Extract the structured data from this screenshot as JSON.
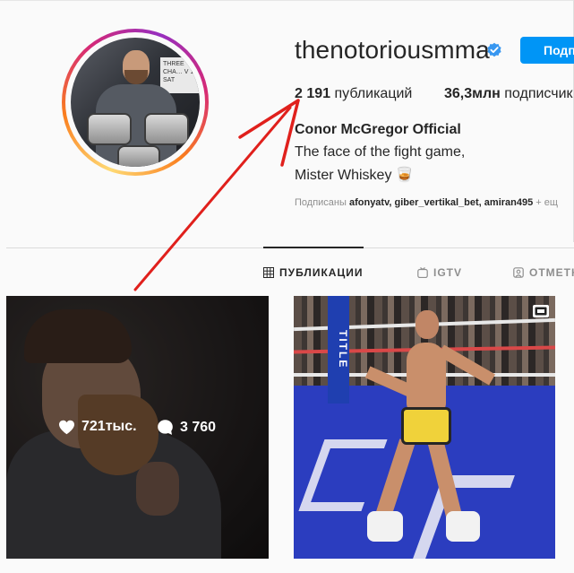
{
  "profile": {
    "username": "thenotoriousmma",
    "follow_label": "Подп",
    "stats": {
      "posts_count": "2 191",
      "posts_label": "публикаций",
      "followers_count": "36,3млн",
      "followers_label": "подписчик"
    },
    "full_name": "Conor McGregor Official",
    "bio": [
      "The face of the fight game,",
      "Mister Whiskey 🥃"
    ],
    "followed_by": {
      "prefix": "Подписаны",
      "accounts": [
        "afonyatv,",
        "giber_vertikal_bet,",
        "amiran495"
      ],
      "suffix": "+ ещ"
    },
    "avatar": {
      "poster_text": "THREE CHA… V 12 SAT"
    }
  },
  "tabs": [
    {
      "label": "ПУБЛИКАЦИИ",
      "icon": "grid-icon",
      "active": true
    },
    {
      "label": "IGTV",
      "icon": "igtv-icon",
      "active": false
    },
    {
      "label": "ОТМЕТК",
      "icon": "tagged-icon",
      "active": false
    }
  ],
  "posts": [
    {
      "likes": "721тыс.",
      "comments": "3 760",
      "hover": true
    },
    {
      "ring_post_text": "TITLE",
      "type": "video"
    }
  ],
  "colors": {
    "accent": "#0095f6",
    "verified": "#3897f0",
    "annotation_arrow": "#e0201c"
  }
}
